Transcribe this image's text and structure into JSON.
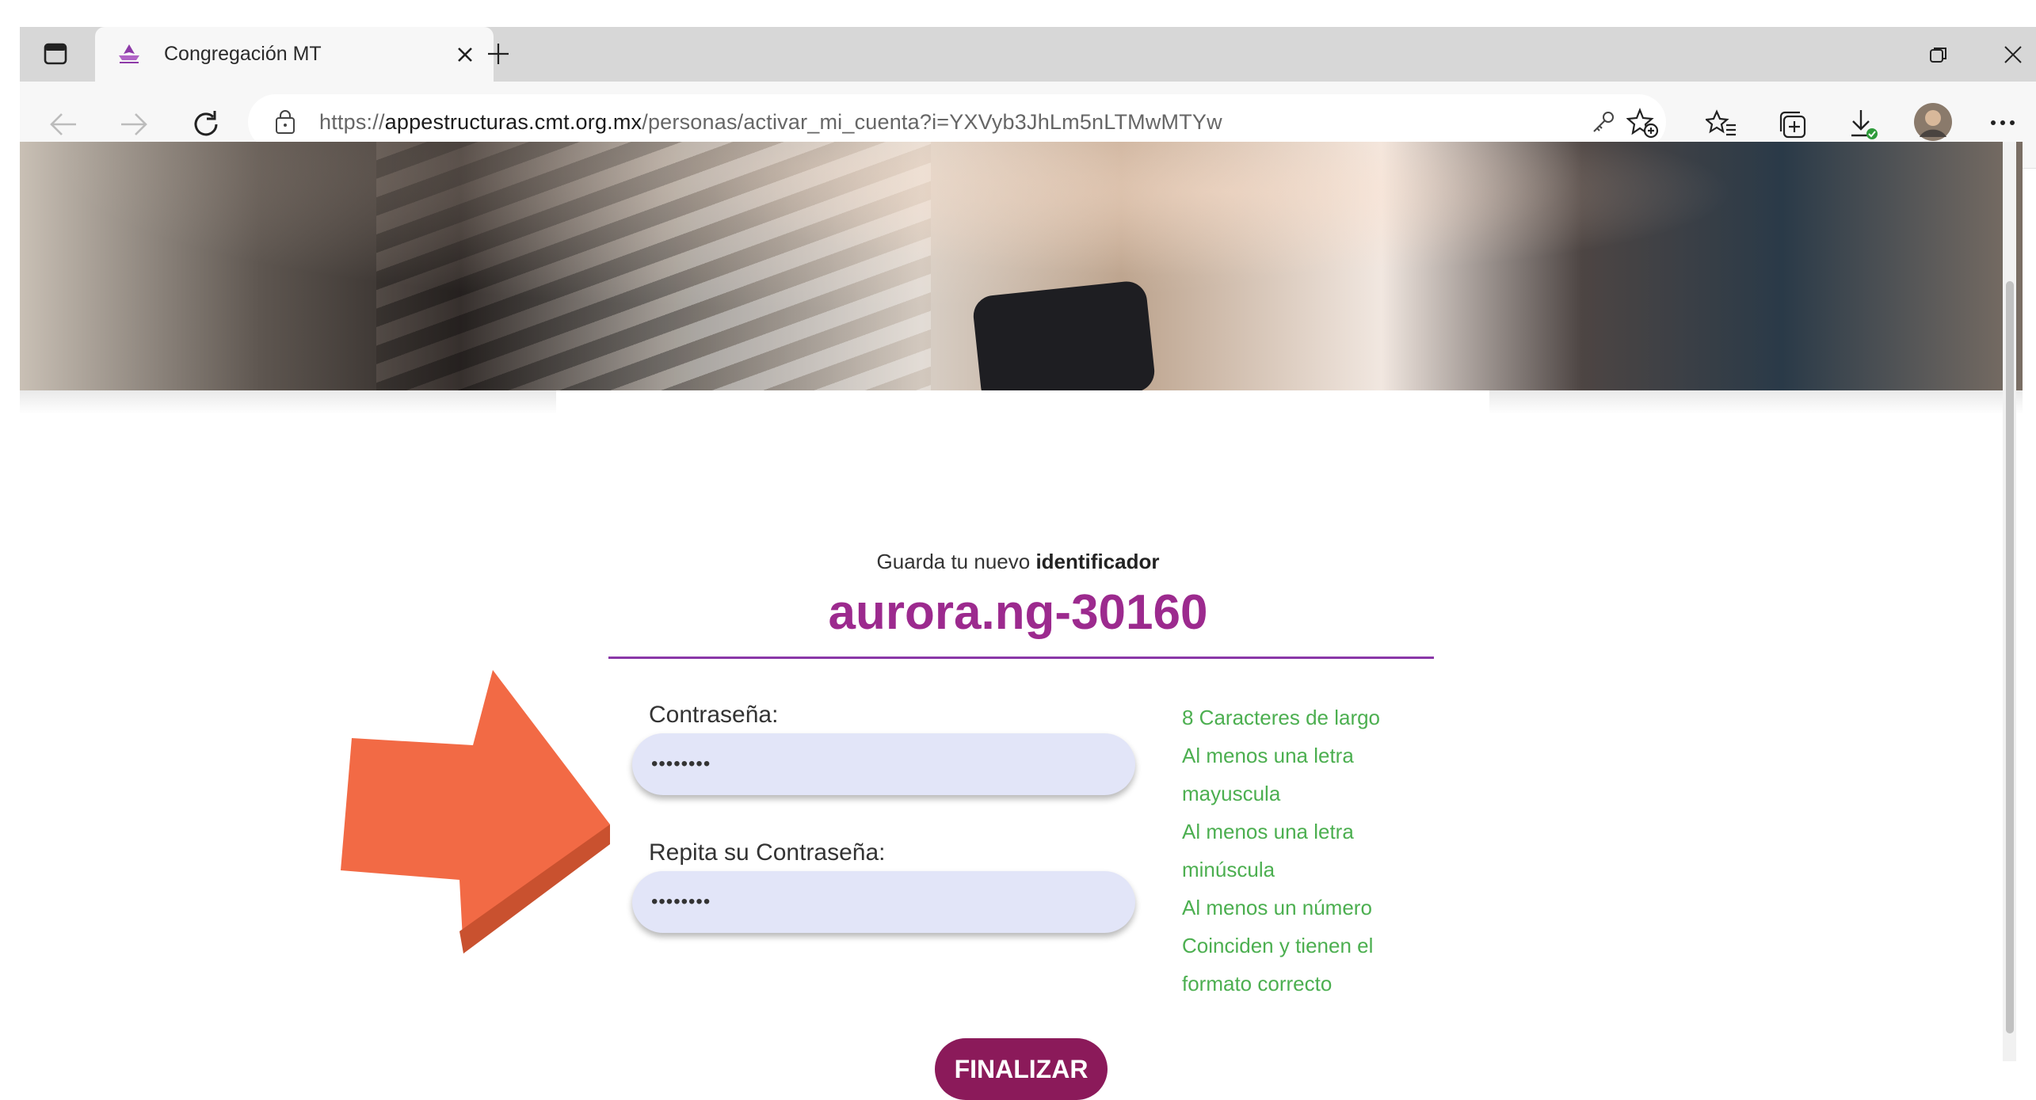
{
  "browser": {
    "tab": {
      "title": "Congregación MT"
    },
    "address_bar": {
      "scheme": "https://",
      "host": "appestructuras.cmt.org.mx",
      "path": "/personas/activar_mi_cuenta?i=YXVyb3JhLm5nLTMwMTYw"
    },
    "icons": [
      "tab-actions-icon",
      "favicon",
      "tab-close-icon",
      "new-tab-icon",
      "restore-window-icon",
      "close-window-icon",
      "back-icon",
      "forward-icon",
      "refresh-icon",
      "site-info-icon",
      "key-icon",
      "add-favorite-icon",
      "favorites-icon",
      "collections-icon",
      "downloads-icon",
      "profile-avatar",
      "more-options-icon"
    ]
  },
  "page": {
    "caption_prefix": "Guarda tu nuevo",
    "caption_bold": "identificador",
    "user_id": "aurora.ng-30160",
    "password_label": "Contraseña:",
    "password_value": "••••••••",
    "repeat_label": "Repita su Contraseña:",
    "repeat_value": "••••••••",
    "rules": [
      "8 Caracteres de largo",
      "Al menos una letra mayuscula",
      "Al menos una letra minúscula",
      "Al menos un número",
      "Coinciden y tienen el formato correcto"
    ],
    "submit_label": "FINALIZAR"
  },
  "colors": {
    "accent_purple": "#9c2a8e",
    "button": "#8b1a5a",
    "rule_green": "#4caf50",
    "input_bg": "#e2e5f8",
    "annotation_arrow": "#f26a45"
  }
}
